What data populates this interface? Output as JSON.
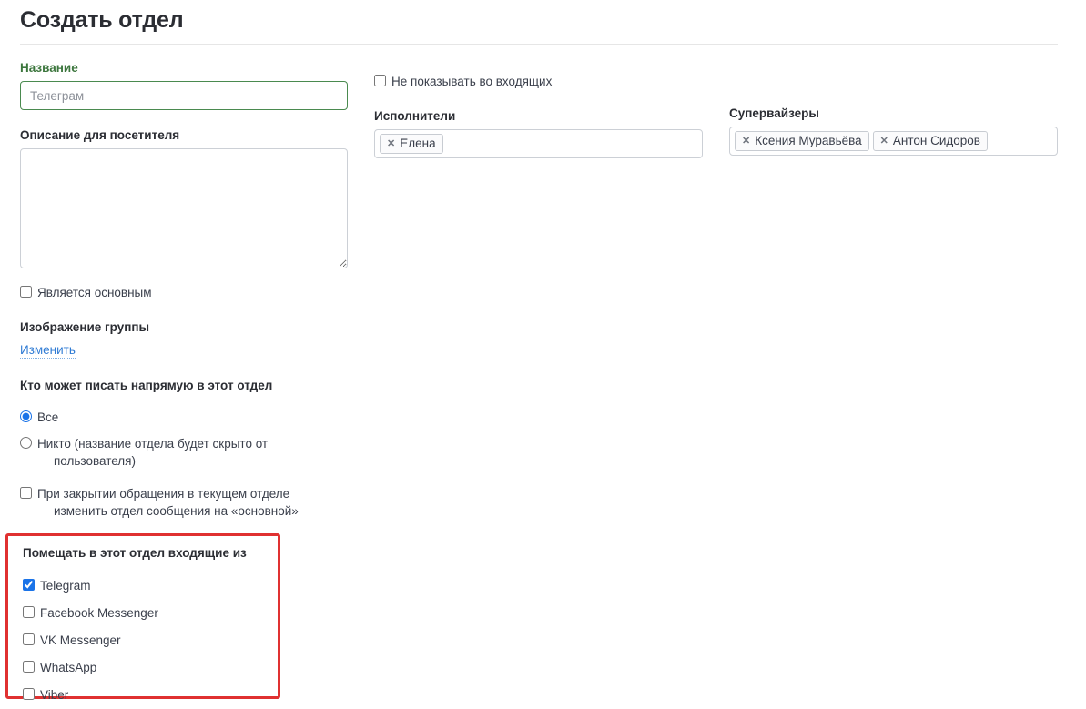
{
  "page": {
    "title": "Создать отдел"
  },
  "left": {
    "name_label": "Название",
    "name_value": "",
    "name_placeholder": "Телеграм",
    "description_label": "Описание для посетителя",
    "description_value": "",
    "description_placeholder": "",
    "is_main_label": "Является основным",
    "group_image_label": "Изображение группы",
    "change_link": "Изменить",
    "who_can_write_label": "Кто может писать напрямую в этот отдел",
    "radio_all": "Все",
    "radio_none_line1": "Никто (название отдела будет скрыто от",
    "radio_none_line2": "пользователя)",
    "close_rule_line1": "При закрытии обращения в текущем отделе",
    "close_rule_line2": "изменить отдел сообщения на «основной»"
  },
  "middle": {
    "hide_in_inbox_label": "Не показывать во входящих",
    "assignees_label": "Исполнители",
    "assignees": [
      {
        "name": "Елена",
        "remove_icon": "close-x-icon"
      }
    ]
  },
  "right": {
    "supervisors_label": "Супервайзеры",
    "supervisors": [
      {
        "name": "Ксения Муравьёва",
        "remove_icon": "close-x-icon"
      },
      {
        "name": "Антон Сидоров",
        "remove_icon": "close-x-icon"
      }
    ]
  },
  "incoming": {
    "title": "Помещать в этот отдел входящие из",
    "highlight_color": "#e03131",
    "channels": [
      {
        "label": "Telegram",
        "checked": true
      },
      {
        "label": "Facebook Messenger",
        "checked": false
      },
      {
        "label": "VK Messenger",
        "checked": false
      },
      {
        "label": "WhatsApp",
        "checked": false
      },
      {
        "label": "Viber",
        "checked": false
      }
    ]
  },
  "colors": {
    "title": "#2b2d33",
    "label_green": "#3c763d",
    "input_border_green": "#4a8a4f",
    "link_blue": "#2f7bd4",
    "accent_blue": "#1a73e8",
    "highlight_red": "#e03131"
  }
}
